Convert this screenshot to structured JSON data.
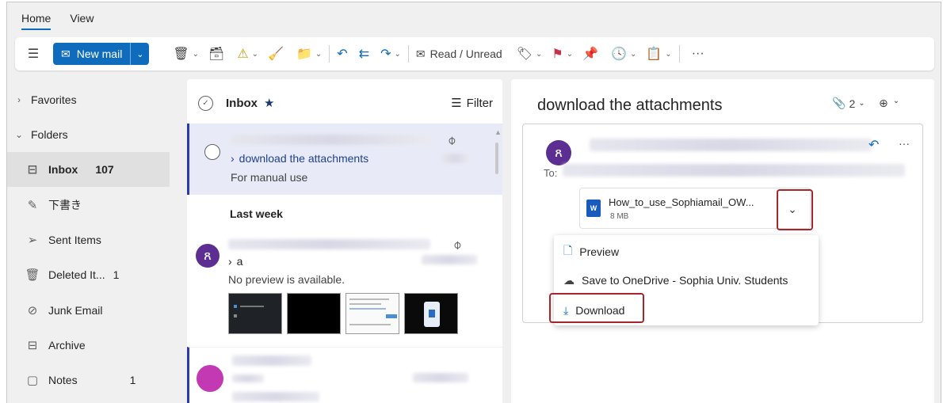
{
  "tabs": [
    "Home",
    "View"
  ],
  "ribbon": {
    "new_mail_label": "New mail",
    "read_unread_label": "Read / Unread",
    "more_label": "···"
  },
  "nav": {
    "favorites": "Favorites",
    "folders": "Folders",
    "items": [
      {
        "label": "Inbox",
        "count": "107",
        "icon": "inbox-icon"
      },
      {
        "label": "下書き",
        "count": "",
        "icon": "drafts-icon"
      },
      {
        "label": "Sent Items",
        "count": "",
        "icon": "send-icon"
      },
      {
        "label": "Deleted It...",
        "count": "1",
        "icon": "trash-icon"
      },
      {
        "label": "Junk Email",
        "count": "",
        "icon": "junk-icon"
      },
      {
        "label": "Archive",
        "count": "",
        "icon": "archive-icon"
      },
      {
        "label": "Notes",
        "count": "1",
        "icon": "notes-icon"
      }
    ]
  },
  "list": {
    "title": "Inbox",
    "filter_label": "Filter",
    "msg1": {
      "subject": "download the attachments",
      "preview": "For manual use"
    },
    "group_label": "Last week",
    "msg2": {
      "subject": "a",
      "preview": "No preview is available."
    }
  },
  "reading": {
    "subject": "download the attachments",
    "attach_count": "2",
    "to_label": "To:",
    "attachment": {
      "name": "How_to_use_Sophiamail_OW...",
      "size": "8 MB"
    },
    "menu": {
      "preview": "Preview",
      "save": "Save to OneDrive - Sophia Univ. Students",
      "download": "Download"
    }
  },
  "colors": {
    "accent": "#0f6cbd",
    "highlight": "#a4262c",
    "avatar": "#5c2e91"
  }
}
